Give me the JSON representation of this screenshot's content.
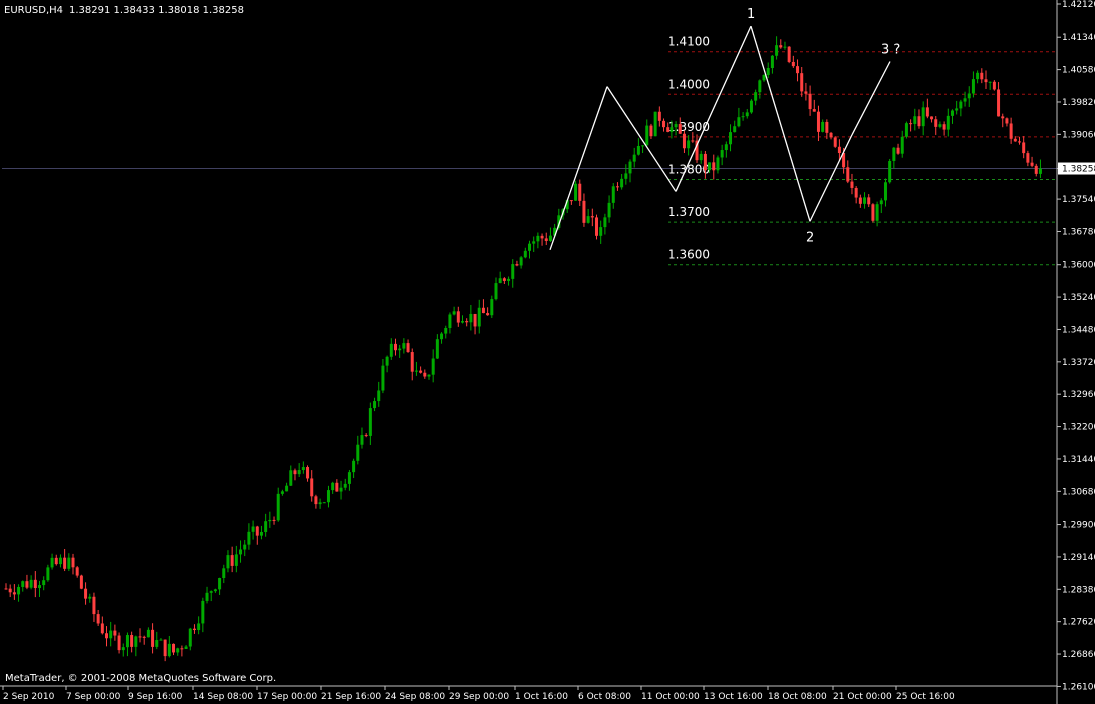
{
  "header": {
    "symbol": "EURUSD,H4",
    "ohlc": "1.38291 1.38433 1.38018 1.38258"
  },
  "copyright": "MetaTrader, © 2001-2008 MetaQuotes Software Corp.",
  "colors": {
    "background": "#000000",
    "axis": "#c0c0c0",
    "bull_candle": "#00aa00",
    "bear_candle": "#ff4040",
    "resistance_line": "#a01010",
    "support_line": "#1a8a1a",
    "pattern_line": "#ffffff",
    "current_price_line": "#404060"
  },
  "chart_data": {
    "type": "candlestick",
    "symbol": "EURUSD",
    "timeframe": "H4",
    "current_price": 1.38258,
    "ylim": [
      1.2611,
      1.4212
    ],
    "y_ticks": [
      "1.42120",
      "1.41340",
      "1.40580",
      "1.39820",
      "1.39060",
      "1.38258",
      "1.37540",
      "1.36780",
      "1.36000",
      "1.35240",
      "1.34480",
      "1.33720",
      "1.32960",
      "1.32200",
      "1.31440",
      "1.30680",
      "1.29900",
      "1.29140",
      "1.28380",
      "1.27620",
      "1.26860",
      "1.26100"
    ],
    "x_ticks": [
      "2 Sep 2010",
      "7 Sep 00:00",
      "9 Sep 16:00",
      "14 Sep 08:00",
      "17 Sep 00:00",
      "21 Sep 16:00",
      "24 Sep 08:00",
      "29 Sep 00:00",
      "1 Oct 16:00",
      "6 Oct 08:00",
      "11 Oct 00:00",
      "13 Oct 16:00",
      "18 Oct 08:00",
      "21 Oct 00:00",
      "25 Oct 16:00"
    ],
    "price_path": [
      [
        0,
        1.284
      ],
      [
        4,
        1.285
      ],
      [
        8,
        1.2865
      ],
      [
        11,
        1.289
      ],
      [
        14,
        1.2905
      ],
      [
        16,
        1.2885
      ],
      [
        19,
        1.282
      ],
      [
        22,
        1.276
      ],
      [
        25,
        1.272
      ],
      [
        28,
        1.2715
      ],
      [
        31,
        1.273
      ],
      [
        34,
        1.2725
      ],
      [
        37,
        1.2705
      ],
      [
        40,
        1.269
      ],
      [
        43,
        1.272
      ],
      [
        46,
        1.278
      ],
      [
        49,
        1.284
      ],
      [
        52,
        1.289
      ],
      [
        55,
        1.292
      ],
      [
        58,
        1.296
      ],
      [
        61,
        1.297
      ],
      [
        64,
        1.302
      ],
      [
        67,
        1.308
      ],
      [
        70,
        1.313
      ],
      [
        73,
        1.306
      ],
      [
        76,
        1.305
      ],
      [
        79,
        1.308
      ],
      [
        82,
        1.312
      ],
      [
        85,
        1.318
      ],
      [
        88,
        1.329
      ],
      [
        91,
        1.338
      ],
      [
        94,
        1.342
      ],
      [
        96,
        1.339
      ],
      [
        98,
        1.334
      ],
      [
        100,
        1.332
      ],
      [
        103,
        1.342
      ],
      [
        106,
        1.348
      ],
      [
        109,
        1.349
      ],
      [
        112,
        1.347
      ],
      [
        115,
        1.349
      ],
      [
        118,
        1.356
      ],
      [
        121,
        1.36
      ],
      [
        124,
        1.365
      ],
      [
        127,
        1.366
      ],
      [
        130,
        1.367
      ],
      [
        133,
        1.372
      ],
      [
        136,
        1.378
      ],
      [
        138,
        1.372
      ],
      [
        140,
        1.369
      ],
      [
        142,
        1.367
      ],
      [
        144,
        1.376
      ],
      [
        147,
        1.382
      ],
      [
        150,
        1.387
      ],
      [
        153,
        1.391
      ],
      [
        156,
        1.395
      ],
      [
        159,
        1.392
      ],
      [
        162,
        1.389
      ],
      [
        165,
        1.386
      ],
      [
        168,
        1.382
      ],
      [
        170,
        1.384
      ],
      [
        173,
        1.39
      ],
      [
        176,
        1.395
      ],
      [
        179,
        1.402
      ],
      [
        182,
        1.408
      ],
      [
        185,
        1.411
      ],
      [
        188,
        1.406
      ],
      [
        191,
        1.399
      ],
      [
        194,
        1.393
      ],
      [
        197,
        1.388
      ],
      [
        200,
        1.383
      ],
      [
        203,
        1.378
      ],
      [
        205,
        1.374
      ],
      [
        207,
        1.372
      ],
      [
        210,
        1.38
      ],
      [
        213,
        1.388
      ],
      [
        216,
        1.393
      ],
      [
        219,
        1.395
      ],
      [
        222,
        1.392
      ],
      [
        225,
        1.394
      ],
      [
        228,
        1.398
      ],
      [
        231,
        1.404
      ],
      [
        233,
        1.405
      ],
      [
        235,
        1.401
      ],
      [
        237,
        1.397
      ],
      [
        239,
        1.392
      ],
      [
        241,
        1.389
      ],
      [
        243,
        1.386
      ],
      [
        245,
        1.3843
      ],
      [
        247,
        1.3826
      ]
    ],
    "horizontal_levels": [
      {
        "label": "1.4100",
        "price": 1.41,
        "type": "resistance"
      },
      {
        "label": "1.4000",
        "price": 1.4,
        "type": "resistance"
      },
      {
        "label": "1.3900",
        "price": 1.39,
        "type": "resistance"
      },
      {
        "label": "1.3800",
        "price": 1.38,
        "type": "support"
      },
      {
        "label": "1.3700",
        "price": 1.37,
        "type": "support"
      },
      {
        "label": "1.3600",
        "price": 1.36,
        "type": "support"
      }
    ],
    "pattern_points": [
      {
        "x": "1 Oct 16:00",
        "price": 1.3635
      },
      {
        "x": "6 Oct 08:00",
        "price": 1.4018
      },
      {
        "x": "11 Oct 00:00",
        "price": 1.3772
      },
      {
        "x": "13 Oct 16:00",
        "price": 1.416
      },
      {
        "x": "18 Oct 08:00",
        "price": 1.3702
      },
      {
        "x": "21 Oct 00:00",
        "price": 1.3905
      },
      {
        "x": "25 Oct 16:00",
        "price": 1.4077
      }
    ],
    "wave_labels": [
      {
        "text": "1",
        "price": 1.416
      },
      {
        "text": "2",
        "price": 1.3702
      },
      {
        "text": "3 ?",
        "price": 1.4077
      }
    ]
  }
}
